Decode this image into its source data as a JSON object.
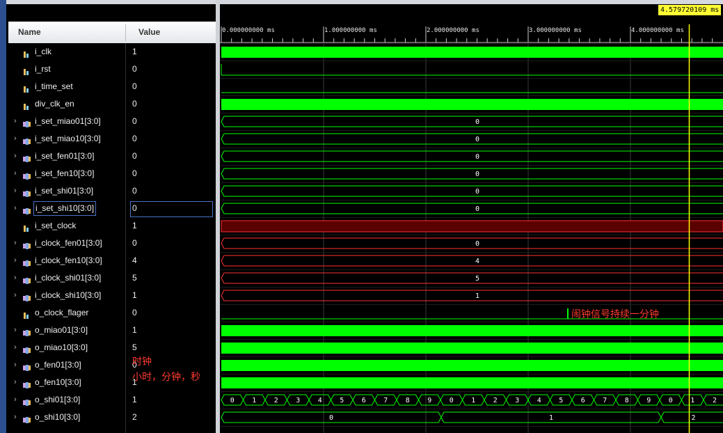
{
  "header": {
    "name_label": "Name",
    "value_label": "Value"
  },
  "cursor": {
    "time_label": "4.579720109 ms"
  },
  "ruler": {
    "labels": [
      "0.000000000 ms",
      "1.000000000 ms",
      "2.000000000 ms",
      "3.000000000 ms",
      "4.000000000 ms"
    ]
  },
  "signals": [
    {
      "name": "i_clk",
      "value": "1",
      "type": "bit",
      "expandable": false
    },
    {
      "name": "i_rst",
      "value": "0",
      "type": "bit",
      "expandable": false
    },
    {
      "name": "i_time_set",
      "value": "0",
      "type": "bit",
      "expandable": false
    },
    {
      "name": "div_clk_en",
      "value": "0",
      "type": "bit",
      "expandable": false
    },
    {
      "name": "i_set_miao01[3:0]",
      "value": "0",
      "type": "bus",
      "expandable": true
    },
    {
      "name": "i_set_miao10[3:0]",
      "value": "0",
      "type": "bus",
      "expandable": true
    },
    {
      "name": "i_set_fen01[3:0]",
      "value": "0",
      "type": "bus",
      "expandable": true
    },
    {
      "name": "i_set_fen10[3:0]",
      "value": "0",
      "type": "bus",
      "expandable": true
    },
    {
      "name": "i_set_shi01[3:0]",
      "value": "0",
      "type": "bus",
      "expandable": true
    },
    {
      "name": "i_set_shi10[3:0]",
      "value": "0",
      "type": "bus",
      "expandable": true,
      "selected": true
    },
    {
      "name": "i_set_clock",
      "value": "1",
      "type": "bit",
      "expandable": false
    },
    {
      "name": "i_clock_fen01[3:0]",
      "value": "0",
      "type": "bus",
      "expandable": true
    },
    {
      "name": "i_clock_fen10[3:0]",
      "value": "4",
      "type": "bus",
      "expandable": true
    },
    {
      "name": "i_clock_shi01[3:0]",
      "value": "5",
      "type": "bus",
      "expandable": true
    },
    {
      "name": "i_clock_shi10[3:0]",
      "value": "1",
      "type": "bus",
      "expandable": true
    },
    {
      "name": "o_clock_flager",
      "value": "0",
      "type": "bit",
      "expandable": false
    },
    {
      "name": "o_miao01[3:0]",
      "value": "1",
      "type": "bus",
      "expandable": true
    },
    {
      "name": "o_miao10[3:0]",
      "value": "5",
      "type": "bus",
      "expandable": true
    },
    {
      "name": "o_fen01[3:0]",
      "value": "0",
      "type": "bus",
      "expandable": true
    },
    {
      "name": "o_fen10[3:0]",
      "value": "1",
      "type": "bus",
      "expandable": true
    },
    {
      "name": "o_shi01[3:0]",
      "value": "1",
      "type": "bus",
      "expandable": true
    },
    {
      "name": "o_shi10[3:0]",
      "value": "2",
      "type": "bus",
      "expandable": true
    }
  ],
  "waves": {
    "bus_labels": {
      "i_set_miao01": "0",
      "i_set_miao10": "0",
      "i_set_fen01": "0",
      "i_set_fen10": "0",
      "i_set_shi01": "0",
      "i_set_shi10": "0",
      "i_clock_fen01": "0",
      "i_clock_fen10": "4",
      "i_clock_shi01": "5",
      "i_clock_shi10": "1"
    },
    "o_shi01_values": [
      "0",
      "1",
      "2",
      "3",
      "4",
      "5",
      "6",
      "7",
      "8",
      "9",
      "0",
      "1",
      "2",
      "3",
      "4",
      "5",
      "6",
      "7",
      "8",
      "9",
      "0",
      "1",
      "2"
    ],
    "o_shi10_values": [
      "0",
      "1",
      "2"
    ]
  },
  "annotations": {
    "alarm_note": "闹钟信号持续一分钟",
    "clock_title": "时钟",
    "clock_units": "小时，分钟，秒"
  },
  "colors": {
    "input_wave": "#00ff00",
    "set_wave": "#ff3030",
    "set_fill": "#5a0000",
    "cursor": "#ffff00",
    "annotation_text": "#ff3b30",
    "selection_border": "#4a72c8"
  }
}
